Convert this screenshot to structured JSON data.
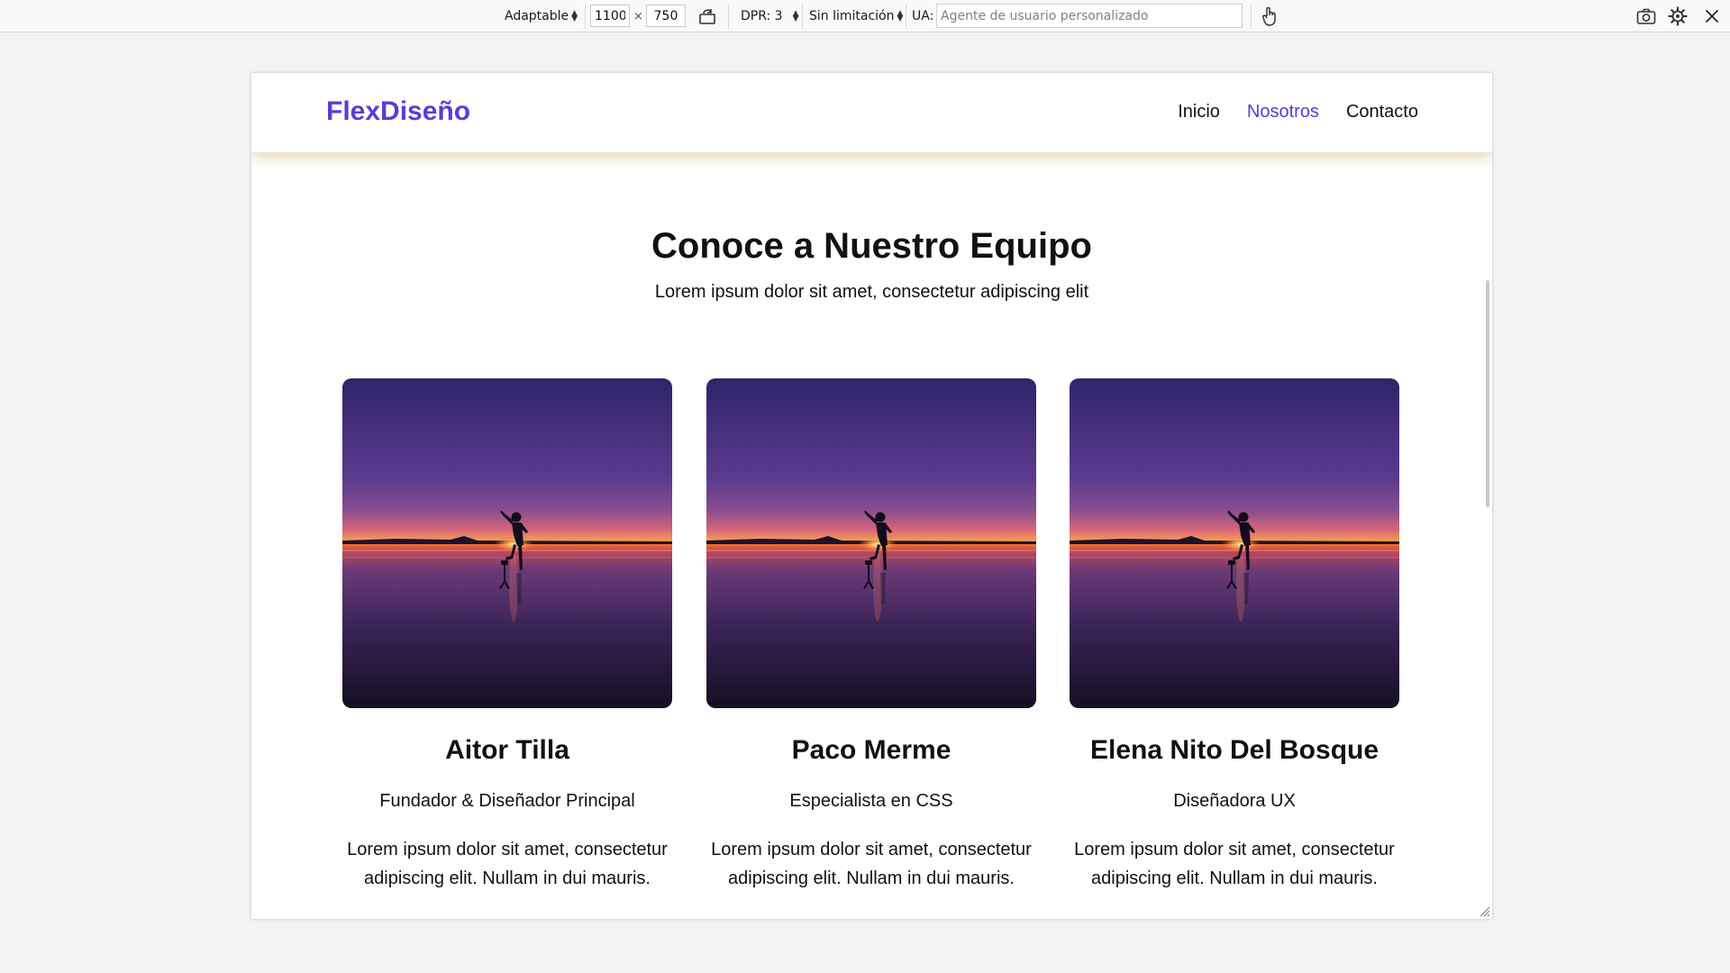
{
  "toolbar": {
    "device_select": "Adaptable",
    "width_value": "1100",
    "times_sign": "×",
    "height_value": "750",
    "dpr_select": "DPR: 3",
    "throttle_select": "Sin limitación",
    "ua_label": "UA:",
    "ua_placeholder": "Agente de usuario personalizado"
  },
  "site": {
    "logo": "FlexDiseño",
    "nav": [
      {
        "label": "Inicio"
      },
      {
        "label": "Nosotros"
      },
      {
        "label": "Contacto"
      }
    ],
    "active_nav": "Nosotros",
    "accent_color": "#5140d8",
    "hero_title": "Conoce a Nuestro Equipo",
    "hero_subtitle": "Lorem ipsum dolor sit amet, consectetur adipiscing elit",
    "team": [
      {
        "name": "Aitor Tilla",
        "role": "Fundador & Diseñador Principal",
        "desc": "Lorem ipsum dolor sit amet, consectetur adipiscing elit. Nullam in dui mauris."
      },
      {
        "name": "Paco Merme",
        "role": "Especialista en CSS",
        "desc": "Lorem ipsum dolor sit amet, consectetur adipiscing elit. Nullam in dui mauris."
      },
      {
        "name": "Elena Nito Del Bosque",
        "role": "Diseñadora UX",
        "desc": "Lorem ipsum dolor sit amet, consectetur adipiscing elit. Nullam in dui mauris."
      }
    ]
  }
}
